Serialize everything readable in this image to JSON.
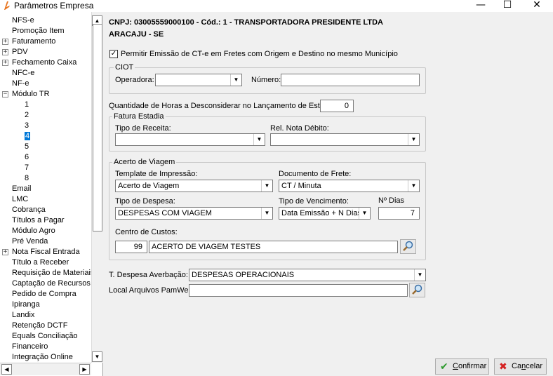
{
  "window": {
    "title": "Parâmetros Empresa",
    "min_glyph": "—",
    "max_glyph": "☐",
    "close_glyph": "✕"
  },
  "tree": {
    "items": [
      {
        "label": "NFS-e",
        "indent": 0,
        "expander": ""
      },
      {
        "label": "Promoção Item",
        "indent": 0,
        "expander": ""
      },
      {
        "label": "Faturamento",
        "indent": 0,
        "expander": "+"
      },
      {
        "label": "PDV",
        "indent": 0,
        "expander": "+"
      },
      {
        "label": "Fechamento Caixa",
        "indent": 0,
        "expander": "+"
      },
      {
        "label": "NFC-e",
        "indent": 0,
        "expander": ""
      },
      {
        "label": "NF-e",
        "indent": 0,
        "expander": ""
      },
      {
        "label": "Módulo TR",
        "indent": 0,
        "expander": "−"
      },
      {
        "label": "1",
        "indent": 1,
        "expander": ""
      },
      {
        "label": "2",
        "indent": 1,
        "expander": ""
      },
      {
        "label": "3",
        "indent": 1,
        "expander": ""
      },
      {
        "label": "4",
        "indent": 1,
        "expander": "",
        "selected": true
      },
      {
        "label": "5",
        "indent": 1,
        "expander": ""
      },
      {
        "label": "6",
        "indent": 1,
        "expander": ""
      },
      {
        "label": "7",
        "indent": 1,
        "expander": ""
      },
      {
        "label": "8",
        "indent": 1,
        "expander": ""
      },
      {
        "label": "Email",
        "indent": 0,
        "expander": ""
      },
      {
        "label": "LMC",
        "indent": 0,
        "expander": ""
      },
      {
        "label": "Cobrança",
        "indent": 0,
        "expander": ""
      },
      {
        "label": "Títulos a Pagar",
        "indent": 0,
        "expander": ""
      },
      {
        "label": "Módulo Agro",
        "indent": 0,
        "expander": ""
      },
      {
        "label": "Pré Venda",
        "indent": 0,
        "expander": ""
      },
      {
        "label": "Nota Fiscal Entrada",
        "indent": 0,
        "expander": "+"
      },
      {
        "label": "Título a Receber",
        "indent": 0,
        "expander": ""
      },
      {
        "label": "Requisição de Materiais",
        "indent": 0,
        "expander": ""
      },
      {
        "label": "Captação de Recursos",
        "indent": 0,
        "expander": ""
      },
      {
        "label": "Pedido de Compra",
        "indent": 0,
        "expander": ""
      },
      {
        "label": "Ipiranga",
        "indent": 0,
        "expander": ""
      },
      {
        "label": "Landix",
        "indent": 0,
        "expander": ""
      },
      {
        "label": "Retenção DCTF",
        "indent": 0,
        "expander": ""
      },
      {
        "label": "Equals Conciliação",
        "indent": 0,
        "expander": ""
      },
      {
        "label": "Financeiro",
        "indent": 0,
        "expander": ""
      },
      {
        "label": "Integração Online",
        "indent": 0,
        "expander": ""
      }
    ]
  },
  "header": {
    "line1": "CNPJ: 03005559000100 - Cód.: 1 - TRANSPORTADORA PRESIDENTE LTDA",
    "line2": "ARACAJU - SE"
  },
  "form": {
    "permitir_cte_label": "Permitir Emissão de CT-e em Fretes com Origem e Destino no mesmo Município",
    "permitir_cte_checked": "✓",
    "ciot": {
      "title": "CIOT",
      "operadora_label": "Operadora:",
      "operadora_value": "",
      "numero_label": "Número:",
      "numero_value": ""
    },
    "horas_label": "Quantidade de Horas a Desconsiderar no Lançamento de Estadia:",
    "horas_value": "0",
    "fatura": {
      "title": "Fatura Estadia",
      "tipo_receita_label": "Tipo de Receita:",
      "tipo_receita_value": "",
      "rel_nota_label": "Rel. Nota Débito:",
      "rel_nota_value": ""
    },
    "acerto": {
      "title": "Acerto de Viagem",
      "template_label": "Template de Impressão:",
      "template_value": "Acerto de Viagem",
      "documento_label": "Documento de Frete:",
      "documento_value": "CT / Minuta",
      "tipo_despesa_label": "Tipo de Despesa:",
      "tipo_despesa_value": "DESPESAS COM VIAGEM",
      "tipo_venc_label": "Tipo de Vencimento:",
      "tipo_venc_value": "Data Emissão + N Dias",
      "ndias_label": "Nº Dias",
      "ndias_value": "7",
      "centro_label": "Centro de Custos:",
      "centro_code": "99",
      "centro_desc": "ACERTO DE VIAGEM TESTES"
    },
    "despesa_averb_label": "T. Despesa Averbação:",
    "despesa_averb_value": "DESPESAS OPERACIONAIS",
    "local_arquivos_label": "Local Arquivos PamWeb:",
    "local_arquivos_value": ""
  },
  "buttons": {
    "confirmar_first": "C",
    "confirmar_rest": "onfirmar",
    "cancelar_first": "Ca",
    "cancelar_u": "n",
    "cancelar_rest": "celar",
    "confirm_icon": "✔",
    "cancel_icon": "✖"
  },
  "colors": {
    "selection": "#0078d7",
    "confirm_icon": "#2e9a2e",
    "cancel_icon": "#d42020",
    "app_icon": "#e8731c"
  },
  "icons": {
    "app": "app-logo-icon",
    "lookup": "search-lookup-icon"
  }
}
